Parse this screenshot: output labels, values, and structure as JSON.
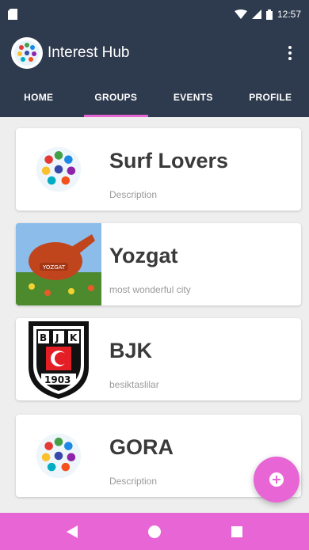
{
  "status_bar": {
    "time": "12:57"
  },
  "app": {
    "title": "Interest Hub"
  },
  "tabs": [
    {
      "label": "HOME"
    },
    {
      "label": "GROUPS"
    },
    {
      "label": "EVENTS"
    },
    {
      "label": "PROFILE"
    }
  ],
  "groups": [
    {
      "name": "Surf Lovers",
      "description": "Description",
      "image": "colorful-people-logo"
    },
    {
      "name": "Yozgat",
      "description": "most wonderful city",
      "image": "yozgat-jug-photo"
    },
    {
      "name": "BJK",
      "description": "besiktaslilar",
      "image": "bjk-crest"
    },
    {
      "name": "GORA",
      "description": "Description",
      "image": "colorful-people-logo"
    }
  ],
  "bjk_crest": {
    "letters": "BJK",
    "year": "1903"
  },
  "yozgat_photo_text": "YOZGAT",
  "colors": {
    "primary": "#2e3a4d",
    "accent": "#e765d4"
  },
  "icons": {
    "fab": "add-circle-icon",
    "nav": [
      "back-icon",
      "home-icon",
      "recents-icon"
    ]
  }
}
